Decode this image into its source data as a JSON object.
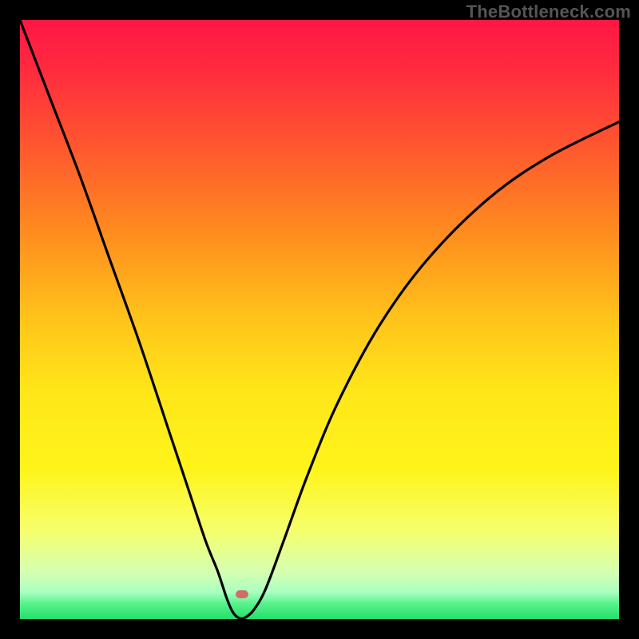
{
  "watermark": "TheBottleneck.com",
  "gradient_stops": [
    {
      "offset": 0.0,
      "color": "#ff1744"
    },
    {
      "offset": 0.08,
      "color": "#ff2a3f"
    },
    {
      "offset": 0.2,
      "color": "#ff5330"
    },
    {
      "offset": 0.35,
      "color": "#ff8a1f"
    },
    {
      "offset": 0.5,
      "color": "#ffc41a"
    },
    {
      "offset": 0.62,
      "color": "#ffe619"
    },
    {
      "offset": 0.75,
      "color": "#fff41a"
    },
    {
      "offset": 0.85,
      "color": "#f6ff6a"
    },
    {
      "offset": 0.92,
      "color": "#d6ffb0"
    },
    {
      "offset": 0.955,
      "color": "#aaffc0"
    },
    {
      "offset": 0.975,
      "color": "#56f28a"
    },
    {
      "offset": 1.0,
      "color": "#22e06a"
    }
  ],
  "marker": {
    "x_frac": 0.37,
    "y_frac": 0.958,
    "color": "#d46a6a"
  },
  "chart_data": {
    "type": "line",
    "title": "",
    "xlabel": "",
    "ylabel": "",
    "xlim": [
      0,
      1
    ],
    "ylim": [
      0,
      1
    ],
    "background": "vertical-gradient-red-to-green",
    "series": [
      {
        "name": "bottleneck-curve",
        "note": "V-shaped curve; y≈1 at left edge, dips to y≈0 near x≈0.37 (minimum marked by dot), rises to y≈0.83 at right edge",
        "x": [
          0.0,
          0.05,
          0.1,
          0.15,
          0.2,
          0.25,
          0.28,
          0.31,
          0.33,
          0.345,
          0.355,
          0.365,
          0.375,
          0.39,
          0.41,
          0.44,
          0.48,
          0.53,
          0.6,
          0.68,
          0.78,
          0.88,
          1.0
        ],
        "y": [
          1.0,
          0.87,
          0.74,
          0.6,
          0.46,
          0.31,
          0.22,
          0.13,
          0.08,
          0.035,
          0.012,
          0.002,
          0.002,
          0.015,
          0.05,
          0.13,
          0.24,
          0.36,
          0.49,
          0.6,
          0.7,
          0.77,
          0.83
        ]
      }
    ],
    "minimum_marker": {
      "x": 0.37,
      "y": 0.002
    }
  }
}
